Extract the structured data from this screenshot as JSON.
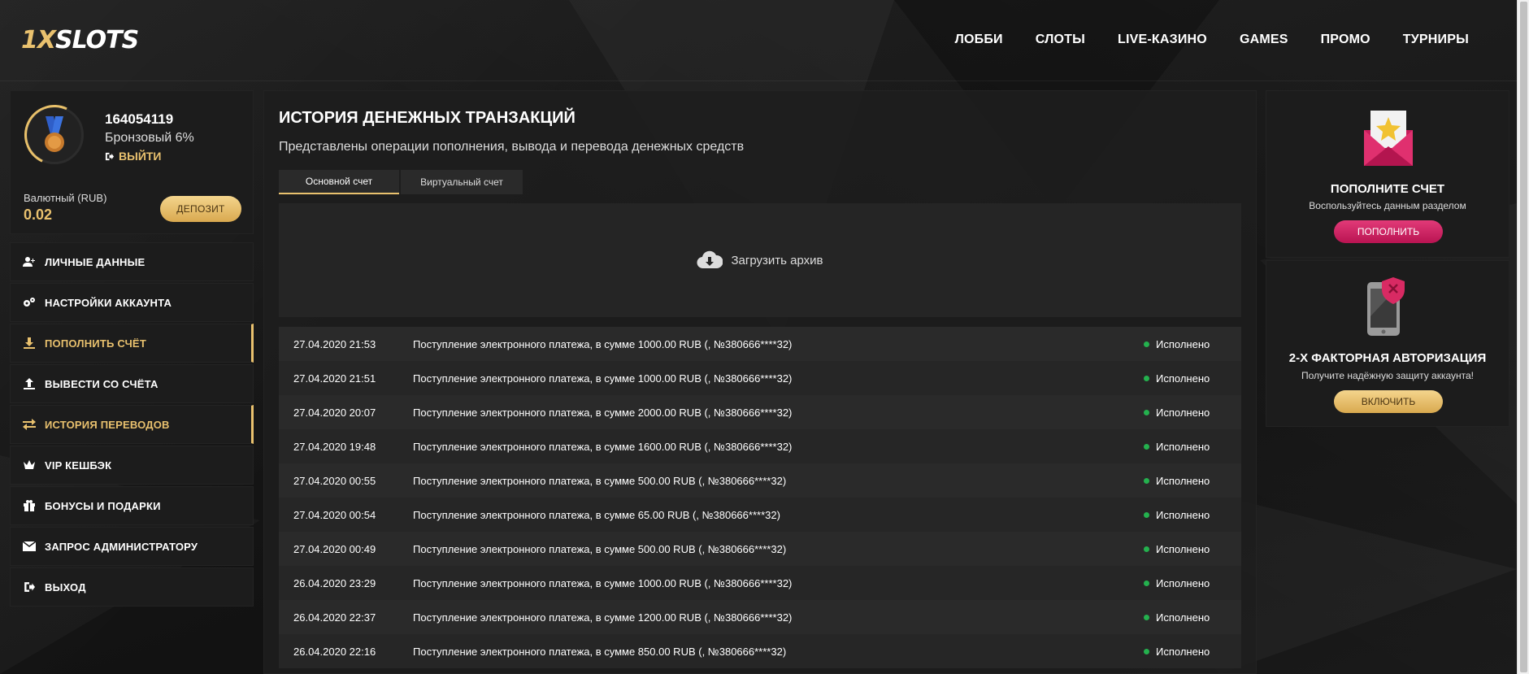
{
  "logo": {
    "part1": "1X",
    "part2": "SLOTS"
  },
  "nav": [
    "ЛОББИ",
    "СЛОТЫ",
    "LIVE-КАЗИНО",
    "GAMES",
    "ПРОМО",
    "ТУРНИРЫ"
  ],
  "profile": {
    "user_id": "164054119",
    "level": "Бронзовый 6%",
    "logout": "ВЫЙТИ",
    "balance_label": "Валютный (RUB)",
    "balance_value": "0.02",
    "deposit_button": "ДЕПОЗИТ"
  },
  "menu": [
    {
      "label": "ЛИЧНЫЕ ДАННЫЕ",
      "icon": "user-plus-icon"
    },
    {
      "label": "НАСТРОЙКИ АККАУНТА",
      "icon": "gears-icon"
    },
    {
      "label": "ПОПОЛНИТЬ СЧЁТ",
      "icon": "download-icon"
    },
    {
      "label": "ВЫВЕСТИ СО СЧЁТА",
      "icon": "upload-icon"
    },
    {
      "label": "ИСТОРИЯ ПЕРЕВОДОВ",
      "icon": "exchange-icon"
    },
    {
      "label": "VIP КЕШБЭК",
      "icon": "crown-icon"
    },
    {
      "label": "БОНУСЫ И ПОДАРКИ",
      "icon": "gift-icon"
    },
    {
      "label": "ЗАПРОС АДМИНИСТРАТОРУ",
      "icon": "envelope-icon"
    },
    {
      "label": "ВЫХОД",
      "icon": "sign-out-icon"
    }
  ],
  "main": {
    "title": "ИСТОРИЯ ДЕНЕЖНЫХ ТРАНЗАКЦИЙ",
    "subtitle": "Представлены операции пополнения, вывода и перевода денежных средств",
    "tabs": [
      "Основной счет",
      "Виртуальный счет"
    ],
    "upload_label": "Загрузить архив",
    "transactions": [
      {
        "date": "27.04.2020 21:53",
        "desc": "Поступление электронного платежа, в сумме 1000.00 RUB (, №380666****32)",
        "status": "Исполнено"
      },
      {
        "date": "27.04.2020 21:51",
        "desc": "Поступление электронного платежа, в сумме 1000.00 RUB (, №380666****32)",
        "status": "Исполнено"
      },
      {
        "date": "27.04.2020 20:07",
        "desc": "Поступление электронного платежа, в сумме 2000.00 RUB (, №380666****32)",
        "status": "Исполнено"
      },
      {
        "date": "27.04.2020 19:48",
        "desc": "Поступление электронного платежа, в сумме 1600.00 RUB (, №380666****32)",
        "status": "Исполнено"
      },
      {
        "date": "27.04.2020 00:55",
        "desc": "Поступление электронного платежа, в сумме 500.00 RUB (, №380666****32)",
        "status": "Исполнено"
      },
      {
        "date": "27.04.2020 00:54",
        "desc": "Поступление электронного платежа, в сумме 65.00 RUB (, №380666****32)",
        "status": "Исполнено"
      },
      {
        "date": "27.04.2020 00:49",
        "desc": "Поступление электронного платежа, в сумме 500.00 RUB (, №380666****32)",
        "status": "Исполнено"
      },
      {
        "date": "26.04.2020 23:29",
        "desc": "Поступление электронного платежа, в сумме 1000.00 RUB (, №380666****32)",
        "status": "Исполнено"
      },
      {
        "date": "26.04.2020 22:37",
        "desc": "Поступление электронного платежа, в сумме 1200.00 RUB (, №380666****32)",
        "status": "Исполнено"
      },
      {
        "date": "26.04.2020 22:16",
        "desc": "Поступление электронного платежа, в сумме 850.00 RUB (, №380666****32)",
        "status": "Исполнено"
      }
    ]
  },
  "cards": {
    "deposit": {
      "title": "ПОПОЛНИТЕ СЧЕТ",
      "desc": "Воспользуйтесь данным разделом",
      "button": "ПОПОЛНИТЬ"
    },
    "twofa": {
      "title": "2-Х ФАКТОРНАЯ АВТОРИЗАЦИЯ",
      "desc": "Получите надёжную защиту аккаунта!",
      "button": "ВКЛЮЧИТЬ"
    }
  },
  "colors": {
    "gold": "#e9c16e",
    "pink": "#c81d5c",
    "status_green": "#24b14e"
  }
}
